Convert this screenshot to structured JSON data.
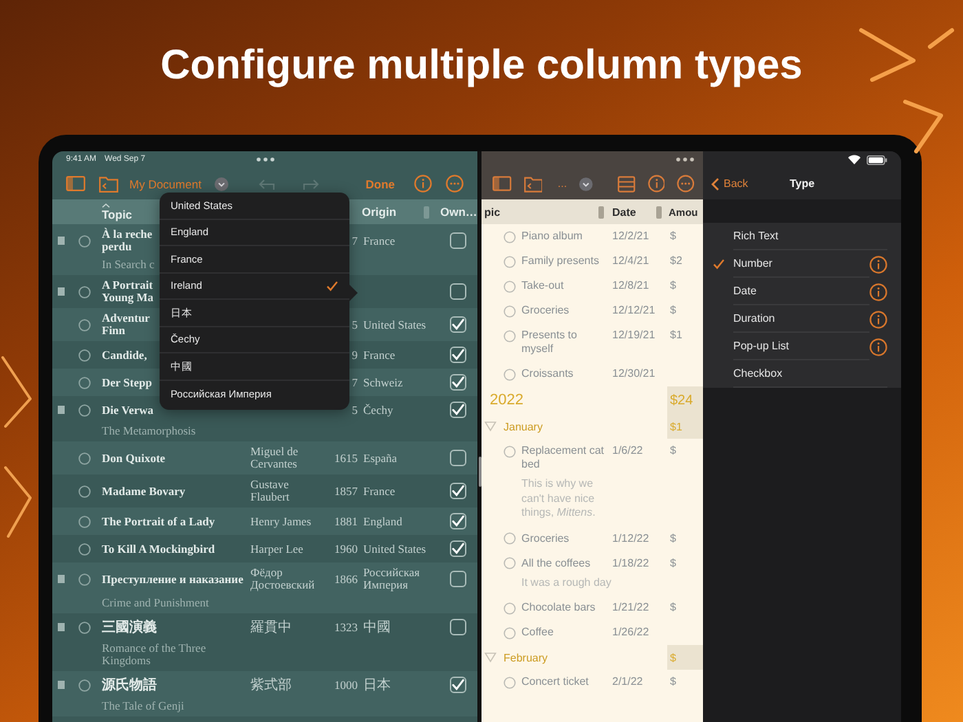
{
  "headline": "Configure multiple column types",
  "left_pane": {
    "status_bar": {
      "time": "9:41 AM",
      "date": "Wed Sep 7"
    },
    "toolbar": {
      "title": "My Document",
      "done": "Done",
      "history": [
        {
          "kind": "undo",
          "disabled": true
        },
        {
          "kind": "redo",
          "disabled": true
        }
      ]
    },
    "columns": {
      "topic": {
        "label": "Topic",
        "sorted": true
      },
      "origin": {
        "label": "Origin"
      },
      "owned": {
        "label": "Own…"
      }
    },
    "rows": [
      {
        "handle": true,
        "topic": "À la reche\nperdu",
        "year": "7",
        "origin": "France",
        "owned": false,
        "note": "In Search c"
      },
      {
        "handle": true,
        "topic": "A Portrait\nYoung Ma",
        "owned": false
      },
      {
        "handle": false,
        "topic": "Adventur\nFinn",
        "year": "5",
        "origin": "United States",
        "owned": true
      },
      {
        "handle": false,
        "topic": "Candide,",
        "year": "9",
        "origin": "France",
        "owned": true
      },
      {
        "handle": false,
        "topic": "Der Stepp",
        "year": "7",
        "origin": "Schweiz",
        "owned": true
      },
      {
        "handle": true,
        "topic": "Die Verwa",
        "year": "5",
        "origin": "Čechy",
        "owned": true,
        "note": "The Metamorphosis"
      },
      {
        "handle": false,
        "topic": "Don Quixote",
        "author": "Miguel de Cervantes",
        "year": "1615",
        "origin": "España",
        "owned": false
      },
      {
        "handle": false,
        "topic": "Madame Bovary",
        "author": "Gustave Flaubert",
        "year": "1857",
        "origin": "France",
        "owned": true
      },
      {
        "handle": false,
        "topic": "The Portrait of a Lady",
        "author": "Henry James",
        "year": "1881",
        "origin": "England",
        "owned": true
      },
      {
        "handle": false,
        "topic": "To Kill A Mockingbird",
        "author": "Harper Lee",
        "year": "1960",
        "origin": "United States",
        "owned": true
      },
      {
        "handle": true,
        "topic": "Преступление и наказание",
        "author": "Фёдор Достоевский",
        "year": "1866",
        "origin": "Российская Империя",
        "owned": false,
        "note": "Crime and Punishment"
      },
      {
        "handle": true,
        "topic": "三國演義",
        "author": "羅貫中",
        "year": "1323",
        "origin": "中國",
        "owned": false,
        "note": "Romance of the Three Kingdoms"
      },
      {
        "handle": true,
        "topic": "源氏物語",
        "author": "紫式部",
        "year": "1000",
        "origin": "日本",
        "owned": true,
        "note": "The Tale of Genji"
      }
    ],
    "popup": {
      "items": [
        {
          "label": "United States",
          "selected": false
        },
        {
          "label": "England",
          "selected": false
        },
        {
          "label": "France",
          "selected": false
        },
        {
          "label": "Ireland",
          "selected": true
        },
        {
          "label": "日本",
          "selected": false
        },
        {
          "label": "Čechy",
          "selected": false
        },
        {
          "label": "中國",
          "selected": false
        },
        {
          "label": "Российская Империя",
          "selected": false
        }
      ]
    }
  },
  "middle_pane": {
    "toolbar": {
      "title": "..."
    },
    "columns": {
      "topic": "pic",
      "date": "Date",
      "amount": "Amou"
    },
    "rows": [
      {
        "kind": "item",
        "title": "Piano album",
        "date": "12/2/21",
        "amount": "$"
      },
      {
        "kind": "item",
        "title": "Family presents",
        "date": "12/4/21",
        "amount": "$2"
      },
      {
        "kind": "item",
        "title": "Take-out",
        "date": "12/8/21",
        "amount": "$"
      },
      {
        "kind": "item",
        "title": "Groceries",
        "date": "12/12/21",
        "amount": "$"
      },
      {
        "kind": "item",
        "title": "Presents to myself",
        "date": "12/19/21",
        "amount": "$1"
      },
      {
        "kind": "item",
        "title": "Croissants",
        "date": "12/30/21"
      },
      {
        "kind": "year",
        "title": "2022",
        "amount": "$24"
      },
      {
        "kind": "month",
        "title": "January",
        "amount": "$1",
        "expanded": true
      },
      {
        "kind": "item",
        "title": "Replacement cat bed",
        "date": "1/6/22",
        "amount": "$"
      },
      {
        "kind": "note",
        "title": "This is why we can't have nice things, *Mittens*."
      },
      {
        "kind": "item",
        "title": "Groceries",
        "date": "1/12/22",
        "amount": "$"
      },
      {
        "kind": "item",
        "title": "All the coffees",
        "date": "1/18/22",
        "amount": "$"
      },
      {
        "kind": "note",
        "title": "It was a rough day"
      },
      {
        "kind": "item",
        "title": "Chocolate bars",
        "date": "1/21/22",
        "amount": "$"
      },
      {
        "kind": "item",
        "title": "Coffee",
        "date": "1/26/22"
      },
      {
        "kind": "month",
        "title": "February",
        "amount": "$",
        "expanded": true
      },
      {
        "kind": "item",
        "title": "Concert ticket",
        "date": "2/1/22",
        "amount": "$"
      }
    ]
  },
  "right_pane": {
    "back": "Back",
    "title": "Type",
    "options": [
      {
        "label": "Rich Text",
        "selected": false,
        "info": false
      },
      {
        "label": "Number",
        "selected": true,
        "info": true
      },
      {
        "label": "Date",
        "selected": false,
        "info": true
      },
      {
        "label": "Duration",
        "selected": false,
        "info": true
      },
      {
        "label": "Pop-up List",
        "selected": false,
        "info": true
      },
      {
        "label": "Checkbox",
        "selected": false,
        "info": false
      }
    ]
  }
}
